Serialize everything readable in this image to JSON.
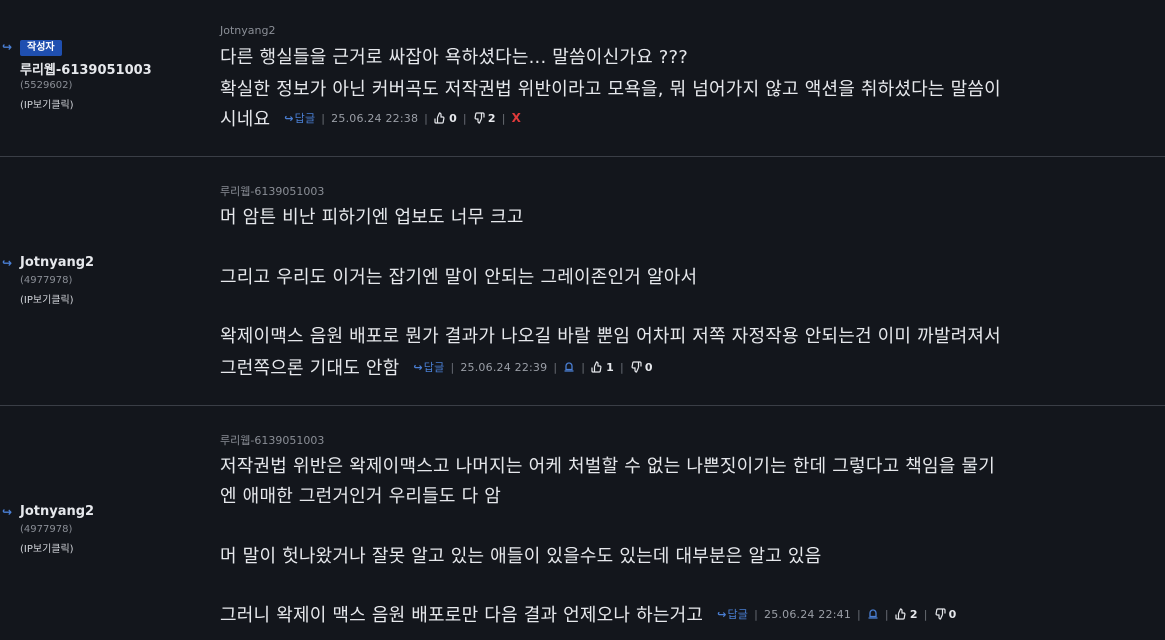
{
  "comments": [
    {
      "author_badge": "작성자",
      "author_name": "루리웹-6139051003",
      "author_id": "(5529602)",
      "author_ip": "(IP보기클릭)",
      "reply_to": "Jotnyang2",
      "lines": [
        "다른 행실들을 근거로 싸잡아 욕하셨다는... 말씀이신가요 ???",
        "확실한 정보가 아닌 커버곡도 저작권법 위반이라고 모욕을, 뭐 넘어가지 않고 액션을 취하셨다는 말씀이",
        "시네요"
      ],
      "reply_label": "답글",
      "timestamp": "25.06.24 22:38",
      "likes": "0",
      "dislikes": "2",
      "delete_label": "X"
    },
    {
      "author_name": "Jotnyang2",
      "author_id": "(4977978)",
      "author_ip": "(IP보기클릭)",
      "reply_to": "루리웹-6139051003",
      "lines": [
        "머 암튼 비난 피하기엔 업보도 너무 크고",
        "",
        "그리고 우리도 이거는 잡기엔 말이 안되는 그레이존인거 알아서",
        "",
        "왁제이맥스 음원 배포로 뭔가 결과가 나오길 바랄 뿐임 어차피 저쪽 자정작용 안되는건 이미 까발려져서",
        "그런쪽으론 기대도 안함"
      ],
      "reply_label": "답글",
      "timestamp": "25.06.24 22:39",
      "likes": "1",
      "dislikes": "0"
    },
    {
      "author_name": "Jotnyang2",
      "author_id": "(4977978)",
      "author_ip": "(IP보기클릭)",
      "reply_to": "루리웹-6139051003",
      "lines": [
        "저작권법 위반은 왁제이맥스고 나머지는 어케 처벌할 수 없는 나쁜짓이기는 한데 그렇다고 책임을 물기",
        "엔 애매한 그런거인거 우리들도 다 암",
        "",
        "머 말이 헛나왔거나 잘못 알고 있는 애들이 있을수도 있는데 대부분은 알고 있음",
        "",
        "그러니 왁제이 맥스 음원 배포로만 다음 결과 언제오나 하는거고"
      ],
      "reply_label": "답글",
      "timestamp": "25.06.24 22:41",
      "likes": "2",
      "dislikes": "0"
    }
  ],
  "icons": {
    "reply_arrow": "↪",
    "thumbs_up": "thumbs-up-icon",
    "thumbs_down": "thumbs-down-icon",
    "bell": "bell-icon"
  },
  "colors": {
    "background": "#13161c",
    "accent": "#4a7fd4",
    "badge": "#1f4fb0",
    "delete": "#e03a3a"
  }
}
